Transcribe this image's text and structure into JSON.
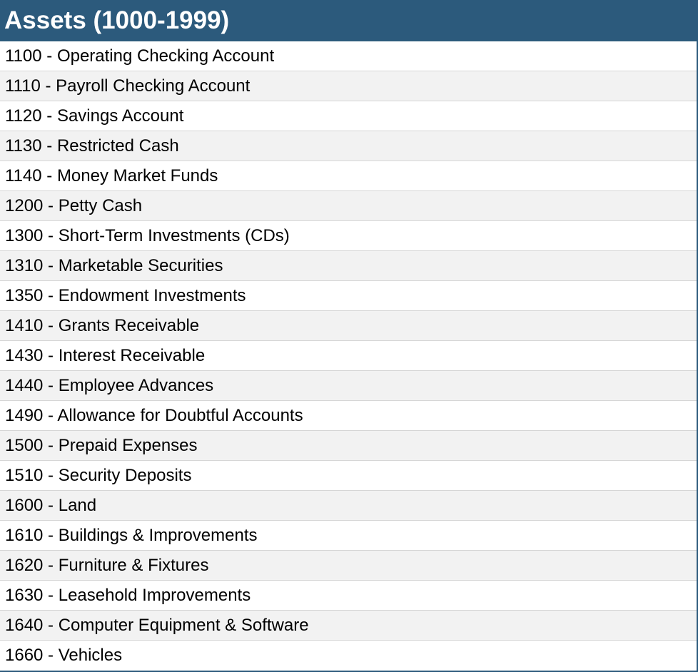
{
  "table": {
    "title": "Assets (1000-1999)",
    "rows": [
      "1100 - Operating Checking Account",
      "1110 - Payroll Checking Account",
      "1120 - Savings Account",
      "1130 - Restricted Cash",
      "1140 - Money Market Funds",
      "1200 - Petty Cash",
      "1300 - Short-Term Investments (CDs)",
      "1310 - Marketable Securities",
      "1350 - Endowment Investments",
      "1410 - Grants Receivable",
      "1430 - Interest Receivable",
      "1440 - Employee Advances",
      "1490 - Allowance for Doubtful Accounts",
      "1500 - Prepaid Expenses",
      "1510 - Security Deposits",
      "1600 - Land",
      "1610 - Buildings & Improvements",
      "1620 - Furniture & Fixtures",
      "1630 - Leasehold Improvements",
      "1640 - Computer Equipment & Software",
      "1660 - Vehicles"
    ]
  },
  "colors": {
    "header_bg": "#2c5a7c",
    "header_text": "#ffffff",
    "row_alt_bg": "#f2f2f2"
  }
}
